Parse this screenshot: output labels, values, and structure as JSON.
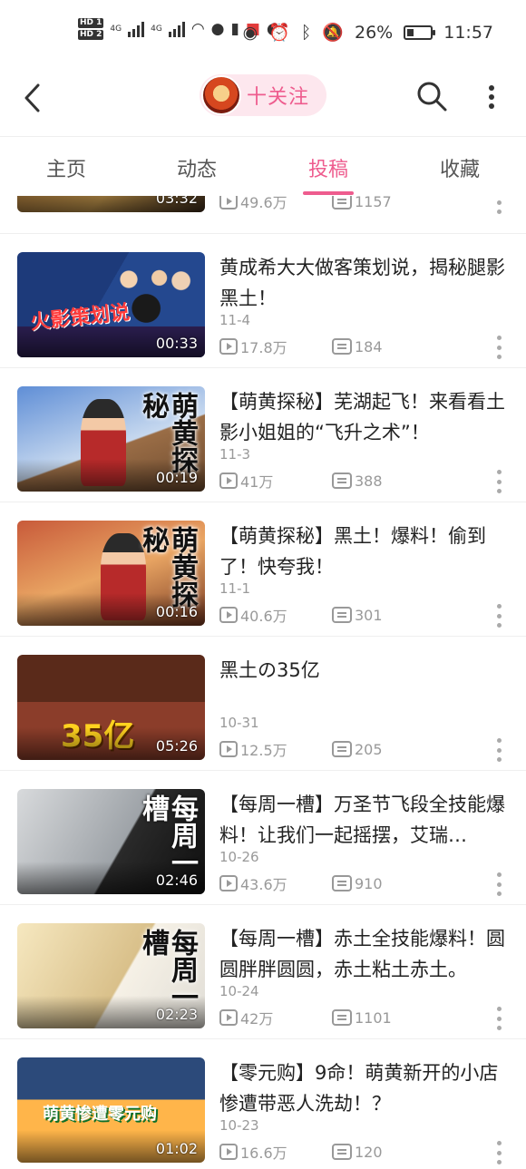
{
  "status_bar": {
    "hd1": "HD 1",
    "hd2": "HD 2",
    "net1": "4G",
    "net2": "4G",
    "battery_percent": "26%",
    "time": "11:57"
  },
  "header": {
    "follow_label": "十关注"
  },
  "tabs": [
    {
      "label": "主页"
    },
    {
      "label": "动态"
    },
    {
      "label": "投稿"
    },
    {
      "label": "收藏"
    }
  ],
  "active_tab": "投稿",
  "videos": [
    {
      "title": "",
      "date": "",
      "duration": "03:32",
      "views": "49.6万",
      "comments": "1157",
      "thumb_text": ""
    },
    {
      "title": "黄成希大大做客策划说，揭秘腿影黑土！",
      "date": "11-4",
      "duration": "00:33",
      "views": "17.8万",
      "comments": "184",
      "thumb_text": "火影策划说"
    },
    {
      "title": "【萌黄探秘】芜湖起飞！来看看土影小姐姐的“飞升之术”！",
      "date": "11-3",
      "duration": "00:19",
      "views": "41万",
      "comments": "388",
      "thumb_text": "萌黄探秘"
    },
    {
      "title": "【萌黄探秘】黑土！爆料！偷到了！快夸我！",
      "date": "11-1",
      "duration": "00:16",
      "views": "40.6万",
      "comments": "301",
      "thumb_text": "萌黄探秘"
    },
    {
      "title": "黑土の35亿",
      "date": "10-31",
      "duration": "05:26",
      "views": "12.5万",
      "comments": "205",
      "thumb_text": "35亿"
    },
    {
      "title": "【每周一槽】万圣节飞段全技能爆料！让我们一起摇摆，艾瑞…",
      "date": "10-26",
      "duration": "02:46",
      "views": "43.6万",
      "comments": "910",
      "thumb_text": "每周一槽"
    },
    {
      "title": "【每周一槽】赤土全技能爆料！圆圆胖胖圆圆，赤土粘土赤土。",
      "date": "10-24",
      "duration": "02:23",
      "views": "42万",
      "comments": "1101",
      "thumb_text": "每周一槽"
    },
    {
      "title": "【零元购】9命！萌黄新开的小店惨遭带恶人洗劫！？",
      "date": "10-23",
      "duration": "01:02",
      "views": "16.6万",
      "comments": "120",
      "thumb_text": "萌黄惨遭零元购"
    }
  ],
  "colors": {
    "accent": "#ee5c8e",
    "pill_bg": "#fde7ee",
    "meta_gray": "#999999"
  },
  "icons": [
    "back-arrow-icon",
    "search-icon",
    "more-vertical-icon",
    "play-count-icon",
    "comment-count-icon",
    "kebab-menu-icon"
  ]
}
